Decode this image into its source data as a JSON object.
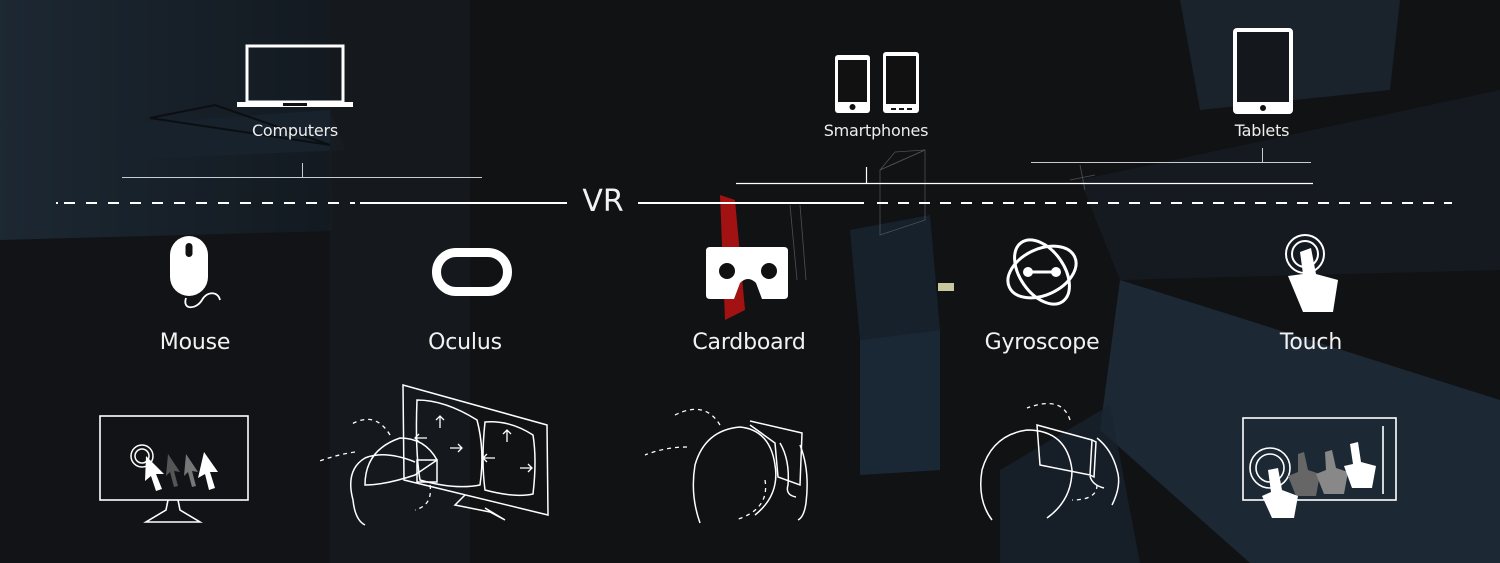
{
  "title": "VR",
  "colors": {
    "background": "#111214",
    "foreground": "#ffffff",
    "scene_blue": "#1c2833",
    "scene_red": "#a01010"
  },
  "devices": [
    {
      "id": "computers",
      "label": "Computers",
      "icon": "laptop-icon"
    },
    {
      "id": "smartphones",
      "label": "Smartphones",
      "icon": "smartphone-icon"
    },
    {
      "id": "tablets",
      "label": "Tablets",
      "icon": "tablet-icon"
    }
  ],
  "inputs": [
    {
      "id": "mouse",
      "label": "Mouse",
      "icon": "mouse-icon",
      "illustration": "monitor-cursor-illustration"
    },
    {
      "id": "oculus",
      "label": "Oculus",
      "icon": "oculus-icon",
      "illustration": "oculus-head-illustration"
    },
    {
      "id": "cardboard",
      "label": "Cardboard",
      "icon": "cardboard-icon",
      "illustration": "cardboard-head-illustration"
    },
    {
      "id": "gyroscope",
      "label": "Gyroscope",
      "icon": "gyroscope-icon",
      "illustration": "gyroscope-head-illustration"
    },
    {
      "id": "touch",
      "label": "Touch",
      "icon": "touch-icon",
      "illustration": "touch-screen-illustration"
    }
  ]
}
